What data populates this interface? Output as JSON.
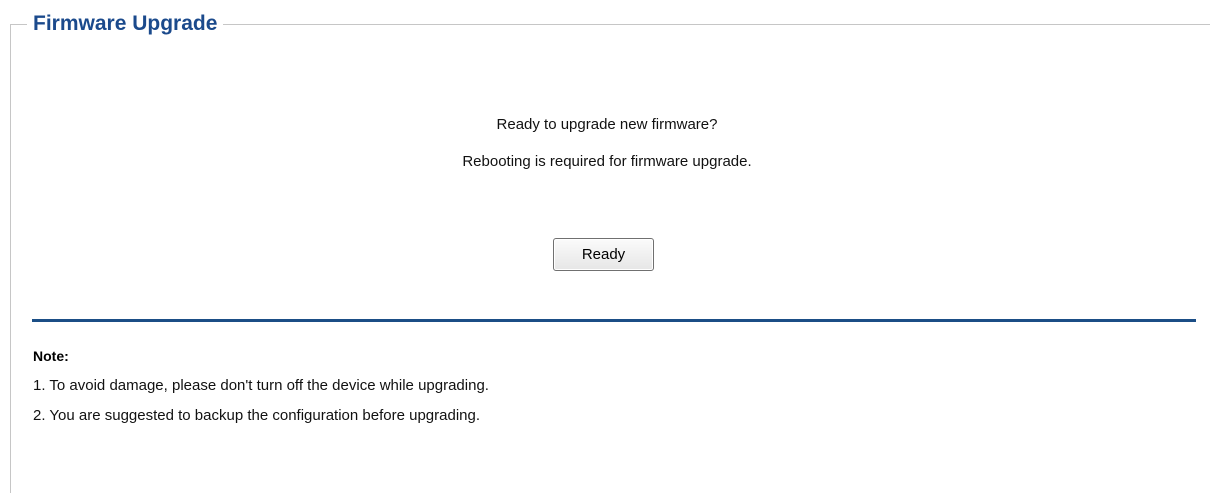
{
  "section": {
    "title": "Firmware Upgrade"
  },
  "prompt": {
    "line1": "Ready to upgrade new firmware?",
    "line2": "Rebooting is required for firmware upgrade."
  },
  "actions": {
    "ready_label": "Ready"
  },
  "note": {
    "title": "Note:",
    "items": [
      "1. To avoid damage, please don't turn off the device while upgrading.",
      "2. You are suggested to backup the configuration before upgrading."
    ]
  },
  "colors": {
    "title": "#1b4a8c",
    "divider": "#1b4e86",
    "frame": "#c6c6c6"
  }
}
